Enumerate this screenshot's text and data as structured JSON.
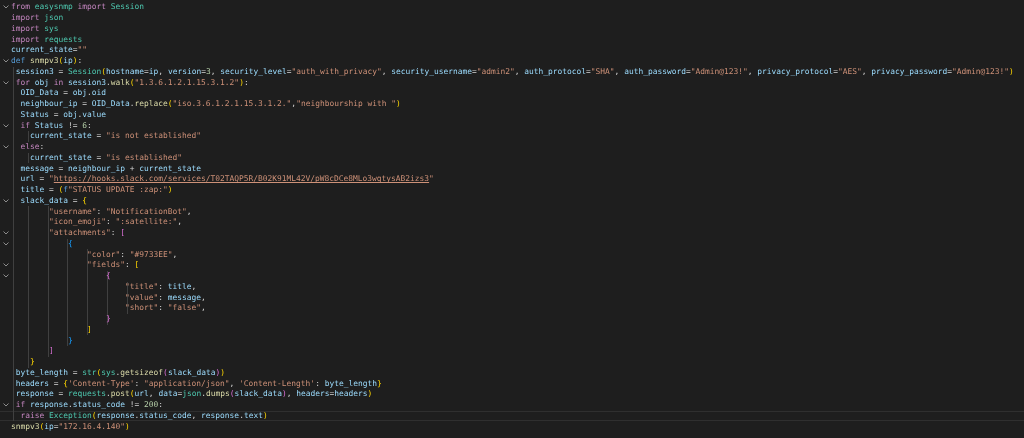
{
  "lines": [
    {
      "foldable": true,
      "current": false,
      "tokens": [
        {
          "text": "from ",
          "kind": "ctl"
        },
        {
          "text": "easysnmp ",
          "kind": "mod"
        },
        {
          "text": "import ",
          "kind": "ctl"
        },
        {
          "text": "Session",
          "kind": "mod"
        }
      ]
    },
    {
      "foldable": false,
      "current": false,
      "tokens": [
        {
          "text": "import ",
          "kind": "ctl"
        },
        {
          "text": "json",
          "kind": "mod"
        }
      ]
    },
    {
      "foldable": false,
      "current": false,
      "tokens": [
        {
          "text": "import ",
          "kind": "ctl"
        },
        {
          "text": "sys",
          "kind": "mod"
        }
      ]
    },
    {
      "foldable": false,
      "current": false,
      "tokens": [
        {
          "text": "import ",
          "kind": "ctl"
        },
        {
          "text": "requests",
          "kind": "mod"
        }
      ]
    },
    {
      "foldable": false,
      "current": false,
      "tokens": [
        {
          "text": "current_state",
          "kind": "var"
        },
        {
          "text": "=",
          "kind": "op"
        },
        {
          "text": "\"\"",
          "kind": "str"
        }
      ]
    },
    {
      "foldable": true,
      "current": false,
      "tokens": [
        {
          "text": "def ",
          "kind": "def"
        },
        {
          "text": "snmpv3",
          "kind": "fn"
        },
        {
          "text": "(",
          "kind": "b1"
        },
        {
          "text": "ip",
          "kind": "var"
        },
        {
          "text": ")",
          "kind": "b1"
        },
        {
          "text": ":",
          "kind": "op"
        }
      ]
    },
    {
      "foldable": false,
      "current": false,
      "tokens": [
        {
          "text": " session3 ",
          "kind": "var"
        },
        {
          "text": "= ",
          "kind": "op"
        },
        {
          "text": "Session",
          "kind": "mod"
        },
        {
          "text": "(",
          "kind": "b1"
        },
        {
          "text": "hostname",
          "kind": "var"
        },
        {
          "text": "=",
          "kind": "op"
        },
        {
          "text": "ip",
          "kind": "var"
        },
        {
          "text": ", ",
          "kind": "op"
        },
        {
          "text": "version",
          "kind": "var"
        },
        {
          "text": "=",
          "kind": "op"
        },
        {
          "text": "3",
          "kind": "num"
        },
        {
          "text": ", ",
          "kind": "op"
        },
        {
          "text": "security_level",
          "kind": "var"
        },
        {
          "text": "=",
          "kind": "op"
        },
        {
          "text": "\"auth_with_privacy\"",
          "kind": "str"
        },
        {
          "text": ", ",
          "kind": "op"
        },
        {
          "text": "security_username",
          "kind": "var"
        },
        {
          "text": "=",
          "kind": "op"
        },
        {
          "text": "\"admin2\"",
          "kind": "str"
        },
        {
          "text": ", ",
          "kind": "op"
        },
        {
          "text": "auth_protocol",
          "kind": "var"
        },
        {
          "text": "=",
          "kind": "op"
        },
        {
          "text": "\"SHA\"",
          "kind": "str"
        },
        {
          "text": ", ",
          "kind": "op"
        },
        {
          "text": "auth_password",
          "kind": "var"
        },
        {
          "text": "=",
          "kind": "op"
        },
        {
          "text": "\"Admin@123!\"",
          "kind": "str"
        },
        {
          "text": ", ",
          "kind": "op"
        },
        {
          "text": "privacy_protocol",
          "kind": "var"
        },
        {
          "text": "=",
          "kind": "op"
        },
        {
          "text": "\"AES\"",
          "kind": "str"
        },
        {
          "text": ", ",
          "kind": "op"
        },
        {
          "text": "privacy_password",
          "kind": "var"
        },
        {
          "text": "=",
          "kind": "op"
        },
        {
          "text": "\"Admin@123!\"",
          "kind": "str"
        },
        {
          "text": ")",
          "kind": "b1"
        }
      ]
    },
    {
      "foldable": true,
      "current": false,
      "tokens": [
        {
          "text": " for ",
          "kind": "ctl"
        },
        {
          "text": "obj ",
          "kind": "var"
        },
        {
          "text": "in ",
          "kind": "ctl"
        },
        {
          "text": "session3",
          "kind": "var"
        },
        {
          "text": ".",
          "kind": "op"
        },
        {
          "text": "walk",
          "kind": "fn"
        },
        {
          "text": "(",
          "kind": "b1"
        },
        {
          "text": "\"1.3.6.1.2.1.15.3.1.2\"",
          "kind": "str"
        },
        {
          "text": ")",
          "kind": "b1"
        },
        {
          "text": ":",
          "kind": "op"
        }
      ]
    },
    {
      "foldable": false,
      "current": false,
      "tokens": [
        {
          "text": "  OID_Data ",
          "kind": "var"
        },
        {
          "text": "= ",
          "kind": "op"
        },
        {
          "text": "obj",
          "kind": "var"
        },
        {
          "text": ".",
          "kind": "op"
        },
        {
          "text": "oid",
          "kind": "var"
        }
      ]
    },
    {
      "foldable": false,
      "current": false,
      "tokens": [
        {
          "text": "  neighbour_ip ",
          "kind": "var"
        },
        {
          "text": "= ",
          "kind": "op"
        },
        {
          "text": "OID_Data",
          "kind": "var"
        },
        {
          "text": ".",
          "kind": "op"
        },
        {
          "text": "replace",
          "kind": "fn"
        },
        {
          "text": "(",
          "kind": "b1"
        },
        {
          "text": "\"iso.3.6.1.2.1.15.3.1.2.\"",
          "kind": "str"
        },
        {
          "text": ",",
          "kind": "op"
        },
        {
          "text": "\"neighbourship with \"",
          "kind": "str"
        },
        {
          "text": ")",
          "kind": "b1"
        }
      ]
    },
    {
      "foldable": false,
      "current": false,
      "tokens": [
        {
          "text": "  Status ",
          "kind": "var"
        },
        {
          "text": "= ",
          "kind": "op"
        },
        {
          "text": "obj",
          "kind": "var"
        },
        {
          "text": ".",
          "kind": "op"
        },
        {
          "text": "value",
          "kind": "var"
        }
      ]
    },
    {
      "foldable": true,
      "current": false,
      "tokens": [
        {
          "text": "  if ",
          "kind": "ctl"
        },
        {
          "text": "Status ",
          "kind": "var"
        },
        {
          "text": "!= ",
          "kind": "op"
        },
        {
          "text": "6",
          "kind": "num"
        },
        {
          "text": ":",
          "kind": "op"
        }
      ]
    },
    {
      "foldable": false,
      "current": false,
      "tokens": [
        {
          "text": "    current_state ",
          "kind": "var"
        },
        {
          "text": "= ",
          "kind": "op"
        },
        {
          "text": "\"is not established\"",
          "kind": "str"
        }
      ]
    },
    {
      "foldable": true,
      "current": false,
      "tokens": [
        {
          "text": "  else",
          "kind": "ctl"
        },
        {
          "text": ":",
          "kind": "op"
        }
      ]
    },
    {
      "foldable": false,
      "current": false,
      "tokens": [
        {
          "text": "    current_state ",
          "kind": "var"
        },
        {
          "text": "= ",
          "kind": "op"
        },
        {
          "text": "\"is established\"",
          "kind": "str"
        }
      ]
    },
    {
      "foldable": false,
      "current": false,
      "tokens": [
        {
          "text": "  message ",
          "kind": "var"
        },
        {
          "text": "= ",
          "kind": "op"
        },
        {
          "text": "neighbour_ip ",
          "kind": "var"
        },
        {
          "text": "+ ",
          "kind": "op"
        },
        {
          "text": "current_state",
          "kind": "var"
        }
      ]
    },
    {
      "foldable": false,
      "current": false,
      "tokens": [
        {
          "text": "  url ",
          "kind": "var"
        },
        {
          "text": "= ",
          "kind": "op"
        },
        {
          "text": "\"",
          "kind": "str"
        },
        {
          "text": "https://hooks.slack.com/services/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",
          "kind": "url"
        },
        {
          "text": "\"",
          "kind": "str"
        }
      ]
    },
    {
      "foldable": false,
      "current": false,
      "tokens": [
        {
          "text": "  title ",
          "kind": "var"
        },
        {
          "text": "= ",
          "kind": "op"
        },
        {
          "text": "(",
          "kind": "b1"
        },
        {
          "text": "f",
          "kind": "def"
        },
        {
          "text": "\"STATUS UPDATE :zap:\"",
          "kind": "str"
        },
        {
          "text": ")",
          "kind": "b1"
        }
      ]
    },
    {
      "foldable": true,
      "current": false,
      "tokens": [
        {
          "text": "  slack_data ",
          "kind": "var"
        },
        {
          "text": "= ",
          "kind": "op"
        },
        {
          "text": "{",
          "kind": "b1"
        }
      ]
    },
    {
      "foldable": false,
      "current": false,
      "tokens": [
        {
          "text": "        \"username\"",
          "kind": "str"
        },
        {
          "text": ": ",
          "kind": "op"
        },
        {
          "text": "\"NotificationBot\"",
          "kind": "str"
        },
        {
          "text": ",",
          "kind": "op"
        }
      ]
    },
    {
      "foldable": false,
      "current": false,
      "tokens": [
        {
          "text": "        \"icon_emoji\"",
          "kind": "str"
        },
        {
          "text": ": ",
          "kind": "op"
        },
        {
          "text": "\":satellite:\"",
          "kind": "str"
        },
        {
          "text": ",",
          "kind": "op"
        }
      ]
    },
    {
      "foldable": true,
      "current": false,
      "tokens": [
        {
          "text": "        \"attachments\"",
          "kind": "str"
        },
        {
          "text": ": ",
          "kind": "op"
        },
        {
          "text": "[",
          "kind": "b2"
        }
      ]
    },
    {
      "foldable": true,
      "current": false,
      "tokens": [
        {
          "text": "            {",
          "kind": "b3"
        }
      ]
    },
    {
      "foldable": false,
      "current": false,
      "tokens": [
        {
          "text": "                \"color\"",
          "kind": "str"
        },
        {
          "text": ": ",
          "kind": "op"
        },
        {
          "text": "\"#9733EE\"",
          "kind": "str"
        },
        {
          "text": ",",
          "kind": "op"
        }
      ]
    },
    {
      "foldable": true,
      "current": false,
      "tokens": [
        {
          "text": "                \"fields\"",
          "kind": "str"
        },
        {
          "text": ": ",
          "kind": "op"
        },
        {
          "text": "[",
          "kind": "b1"
        }
      ]
    },
    {
      "foldable": true,
      "current": false,
      "tokens": [
        {
          "text": "                    {",
          "kind": "b2"
        }
      ]
    },
    {
      "foldable": false,
      "current": false,
      "tokens": [
        {
          "text": "                        \"title\"",
          "kind": "str"
        },
        {
          "text": ": ",
          "kind": "op"
        },
        {
          "text": "title",
          "kind": "var"
        },
        {
          "text": ",",
          "kind": "op"
        }
      ]
    },
    {
      "foldable": false,
      "current": false,
      "tokens": [
        {
          "text": "                        \"value\"",
          "kind": "str"
        },
        {
          "text": ": ",
          "kind": "op"
        },
        {
          "text": "message",
          "kind": "var"
        },
        {
          "text": ",",
          "kind": "op"
        }
      ]
    },
    {
      "foldable": false,
      "current": false,
      "tokens": [
        {
          "text": "                        \"short\"",
          "kind": "str"
        },
        {
          "text": ": ",
          "kind": "op"
        },
        {
          "text": "\"false\"",
          "kind": "str"
        },
        {
          "text": ",",
          "kind": "op"
        }
      ]
    },
    {
      "foldable": false,
      "current": false,
      "tokens": [
        {
          "text": "                    }",
          "kind": "b2"
        }
      ]
    },
    {
      "foldable": false,
      "current": false,
      "tokens": [
        {
          "text": "                ]",
          "kind": "b1"
        }
      ]
    },
    {
      "foldable": false,
      "current": false,
      "tokens": [
        {
          "text": "            }",
          "kind": "b3"
        }
      ]
    },
    {
      "foldable": false,
      "current": false,
      "tokens": [
        {
          "text": "        ]",
          "kind": "b2"
        }
      ]
    },
    {
      "foldable": false,
      "current": false,
      "tokens": [
        {
          "text": "    }",
          "kind": "b1"
        }
      ]
    },
    {
      "foldable": false,
      "current": false,
      "tokens": [
        {
          "text": " byte_length ",
          "kind": "var"
        },
        {
          "text": "= ",
          "kind": "op"
        },
        {
          "text": "str",
          "kind": "mod"
        },
        {
          "text": "(",
          "kind": "b1"
        },
        {
          "text": "sys",
          "kind": "mod"
        },
        {
          "text": ".",
          "kind": "op"
        },
        {
          "text": "getsizeof",
          "kind": "fn"
        },
        {
          "text": "(",
          "kind": "b2"
        },
        {
          "text": "slack_data",
          "kind": "var"
        },
        {
          "text": ")",
          "kind": "b2"
        },
        {
          "text": ")",
          "kind": "b1"
        }
      ]
    },
    {
      "foldable": false,
      "current": false,
      "tokens": [
        {
          "text": " headers ",
          "kind": "var"
        },
        {
          "text": "= ",
          "kind": "op"
        },
        {
          "text": "{",
          "kind": "b1"
        },
        {
          "text": "'Content-Type'",
          "kind": "str"
        },
        {
          "text": ": ",
          "kind": "op"
        },
        {
          "text": "\"application/json\"",
          "kind": "str"
        },
        {
          "text": ", ",
          "kind": "op"
        },
        {
          "text": "'Content-Length'",
          "kind": "str"
        },
        {
          "text": ": ",
          "kind": "op"
        },
        {
          "text": "byte_length",
          "kind": "var"
        },
        {
          "text": "}",
          "kind": "b1"
        }
      ]
    },
    {
      "foldable": false,
      "current": false,
      "tokens": [
        {
          "text": " response ",
          "kind": "var"
        },
        {
          "text": "= ",
          "kind": "op"
        },
        {
          "text": "requests",
          "kind": "mod"
        },
        {
          "text": ".",
          "kind": "op"
        },
        {
          "text": "post",
          "kind": "fn"
        },
        {
          "text": "(",
          "kind": "b1"
        },
        {
          "text": "url",
          "kind": "var"
        },
        {
          "text": ", ",
          "kind": "op"
        },
        {
          "text": "data",
          "kind": "var"
        },
        {
          "text": "=",
          "kind": "op"
        },
        {
          "text": "json",
          "kind": "mod"
        },
        {
          "text": ".",
          "kind": "op"
        },
        {
          "text": "dumps",
          "kind": "fn"
        },
        {
          "text": "(",
          "kind": "b2"
        },
        {
          "text": "slack_data",
          "kind": "var"
        },
        {
          "text": ")",
          "kind": "b2"
        },
        {
          "text": ", ",
          "kind": "op"
        },
        {
          "text": "headers",
          "kind": "var"
        },
        {
          "text": "=",
          "kind": "op"
        },
        {
          "text": "headers",
          "kind": "var"
        },
        {
          "text": ")",
          "kind": "b1"
        }
      ]
    },
    {
      "foldable": true,
      "current": false,
      "tokens": [
        {
          "text": " if ",
          "kind": "ctl"
        },
        {
          "text": "response",
          "kind": "var"
        },
        {
          "text": ".",
          "kind": "op"
        },
        {
          "text": "status_code ",
          "kind": "var"
        },
        {
          "text": "!= ",
          "kind": "op"
        },
        {
          "text": "200",
          "kind": "num"
        },
        {
          "text": ":",
          "kind": "op"
        }
      ]
    },
    {
      "foldable": false,
      "current": true,
      "tokens": [
        {
          "text": "  raise ",
          "kind": "ctl"
        },
        {
          "text": "Exception",
          "kind": "mod"
        },
        {
          "text": "(",
          "kind": "b1"
        },
        {
          "text": "response",
          "kind": "var"
        },
        {
          "text": ".",
          "kind": "op"
        },
        {
          "text": "status_code",
          "kind": "var"
        },
        {
          "text": ", ",
          "kind": "op"
        },
        {
          "text": "response",
          "kind": "var"
        },
        {
          "text": ".",
          "kind": "op"
        },
        {
          "text": "text",
          "kind": "var"
        },
        {
          "text": ")",
          "kind": "b1"
        }
      ]
    },
    {
      "foldable": false,
      "current": false,
      "tokens": [
        {
          "text": "snmpv3",
          "kind": "fn"
        },
        {
          "text": "(",
          "kind": "b1"
        },
        {
          "text": "ip",
          "kind": "var"
        },
        {
          "text": "=",
          "kind": "op"
        },
        {
          "text": "\"172.16.4.140\"",
          "kind": "str"
        },
        {
          "text": ")",
          "kind": "b1"
        }
      ]
    }
  ]
}
